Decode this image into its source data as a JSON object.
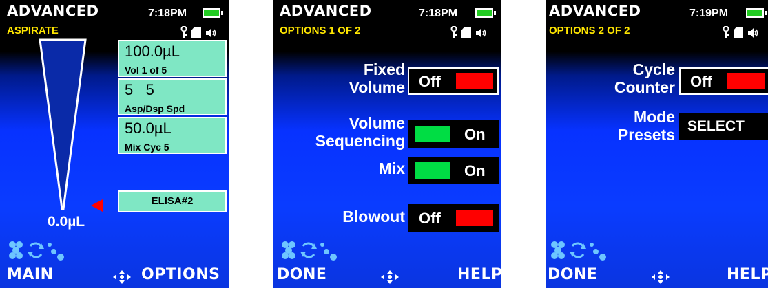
{
  "screens": [
    {
      "title": "ADVANCED",
      "subtitle": "ASPIRATE",
      "time": "7:18PM",
      "volume_readout": "0.0µL",
      "tiles": [
        {
          "big": "100.0µL",
          "small": "Vol 1 of 5"
        },
        {
          "big": "5   5",
          "small": "Asp/Dsp Spd"
        },
        {
          "big": "50.0µL",
          "small": "Mix Cyc 5"
        }
      ],
      "program_label": "ELISA#2",
      "footer_left": "MAIN",
      "footer_right": "OPTIONS"
    },
    {
      "title": "ADVANCED",
      "subtitle": "OPTIONS 1 OF 2",
      "time": "7:18PM",
      "options": [
        {
          "label_line1": "Fixed",
          "label_line2": "Volume",
          "state": "Off"
        },
        {
          "label_line1": "Volume",
          "label_line2": "Sequencing",
          "state": "On"
        },
        {
          "label_line1": "Mix",
          "label_line2": "",
          "state": "On"
        },
        {
          "label_line1": "Blowout",
          "label_line2": "",
          "state": "Off"
        }
      ],
      "footer_left": "DONE",
      "footer_right": "HELP"
    },
    {
      "title": "ADVANCED",
      "subtitle": "OPTIONS 2 OF 2",
      "time": "7:19PM",
      "options": [
        {
          "label_line1": "Cycle",
          "label_line2": "Counter",
          "state": "Off"
        },
        {
          "label_line1": "Mode",
          "label_line2": "Presets",
          "state": "SELECT"
        }
      ],
      "footer_left": "DONE",
      "footer_right": "HELP"
    }
  ],
  "colors": {
    "accent_yellow": "#ffe600",
    "tile_green": "#7fe7c4",
    "switch_on": "#00dd44",
    "switch_off": "#ff0000",
    "battery": "#22cc22"
  },
  "icons": [
    "battery-icon",
    "key-icon",
    "memory-card-icon",
    "speaker-icon",
    "tip-eject-icon",
    "cycle-icon",
    "droplets-icon",
    "dpad-icon",
    "volume-marker-icon"
  ]
}
